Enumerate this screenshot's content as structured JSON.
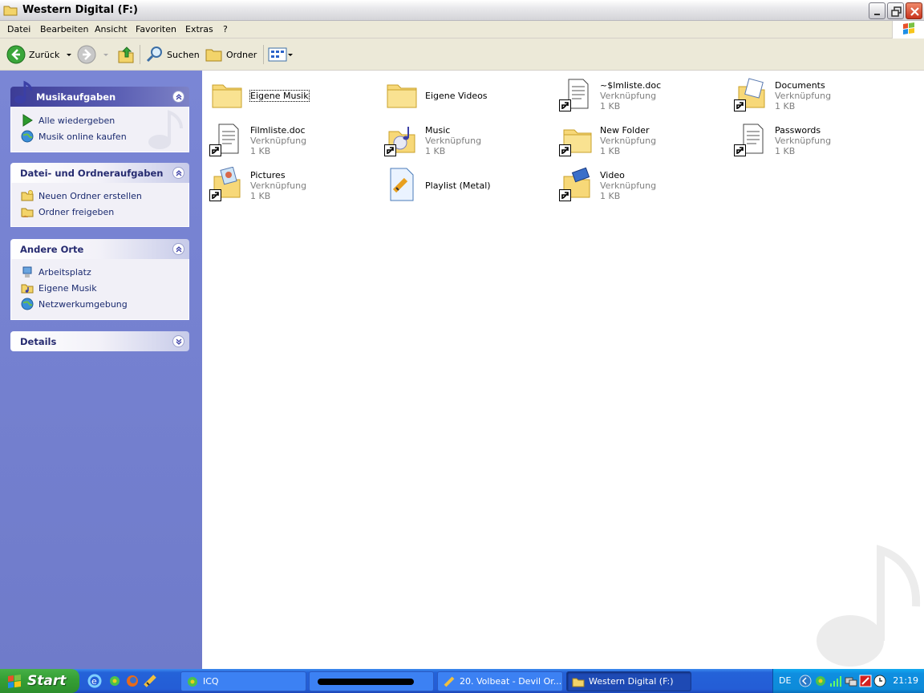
{
  "window": {
    "title": "Western Digital (F:)"
  },
  "menu": [
    "Datei",
    "Bearbeiten",
    "Ansicht",
    "Favoriten",
    "Extras",
    "?"
  ],
  "toolbar": {
    "back_label": "Zurück",
    "search_label": "Suchen",
    "folders_label": "Ordner"
  },
  "sidebar": {
    "music_tasks": {
      "title": "Musikaufgaben",
      "items": [
        "Alle wiedergeben",
        "Musik online kaufen"
      ]
    },
    "file_tasks": {
      "title": "Datei- und Ordneraufgaben",
      "items": [
        "Neuen Ordner erstellen",
        "Ordner freigeben"
      ]
    },
    "other_places": {
      "title": "Andere Orte",
      "items": [
        "Arbeitsplatz",
        "Eigene Musik",
        "Netzwerkumgebung"
      ]
    },
    "details": {
      "title": "Details"
    }
  },
  "files": [
    {
      "name": "Eigene Musik",
      "type": "",
      "size": "",
      "icon": "folder-icon",
      "selected": true
    },
    {
      "name": "Eigene Videos",
      "type": "",
      "size": "",
      "icon": "folder-icon"
    },
    {
      "name": "~$lmliste.doc",
      "type": "Verknüpfung",
      "size": "1 KB",
      "icon": "document-shortcut-icon"
    },
    {
      "name": "Documents",
      "type": "Verknüpfung",
      "size": "1 KB",
      "icon": "documents-folder-shortcut-icon"
    },
    {
      "name": "Filmliste.doc",
      "type": "Verknüpfung",
      "size": "1 KB",
      "icon": "document-shortcut-icon"
    },
    {
      "name": "Music",
      "type": "Verknüpfung",
      "size": "1 KB",
      "icon": "music-folder-shortcut-icon"
    },
    {
      "name": "New Folder",
      "type": "Verknüpfung",
      "size": "1 KB",
      "icon": "folder-shortcut-icon"
    },
    {
      "name": "Passwords",
      "type": "Verknüpfung",
      "size": "1 KB",
      "icon": "document-shortcut-icon"
    },
    {
      "name": "Pictures",
      "type": "Verknüpfung",
      "size": "1 KB",
      "icon": "pictures-folder-shortcut-icon"
    },
    {
      "name": "Playlist (Metal)",
      "type": "",
      "size": "",
      "icon": "playlist-icon"
    },
    {
      "name": "Video",
      "type": "Verknüpfung",
      "size": "1 KB",
      "icon": "video-folder-shortcut-icon"
    }
  ],
  "taskbar": {
    "start_label": "Start",
    "buttons": [
      "ICQ",
      "",
      "20. Volbeat - Devil Or...",
      "Western Digital (F:)"
    ],
    "language": "DE",
    "clock": "21:19"
  },
  "colors": {
    "sidebar_bg": "#7a86d5",
    "taskbar_blue": "#245dd6",
    "start_green": "#36a036",
    "tray_blue": "#0f8ee0"
  }
}
